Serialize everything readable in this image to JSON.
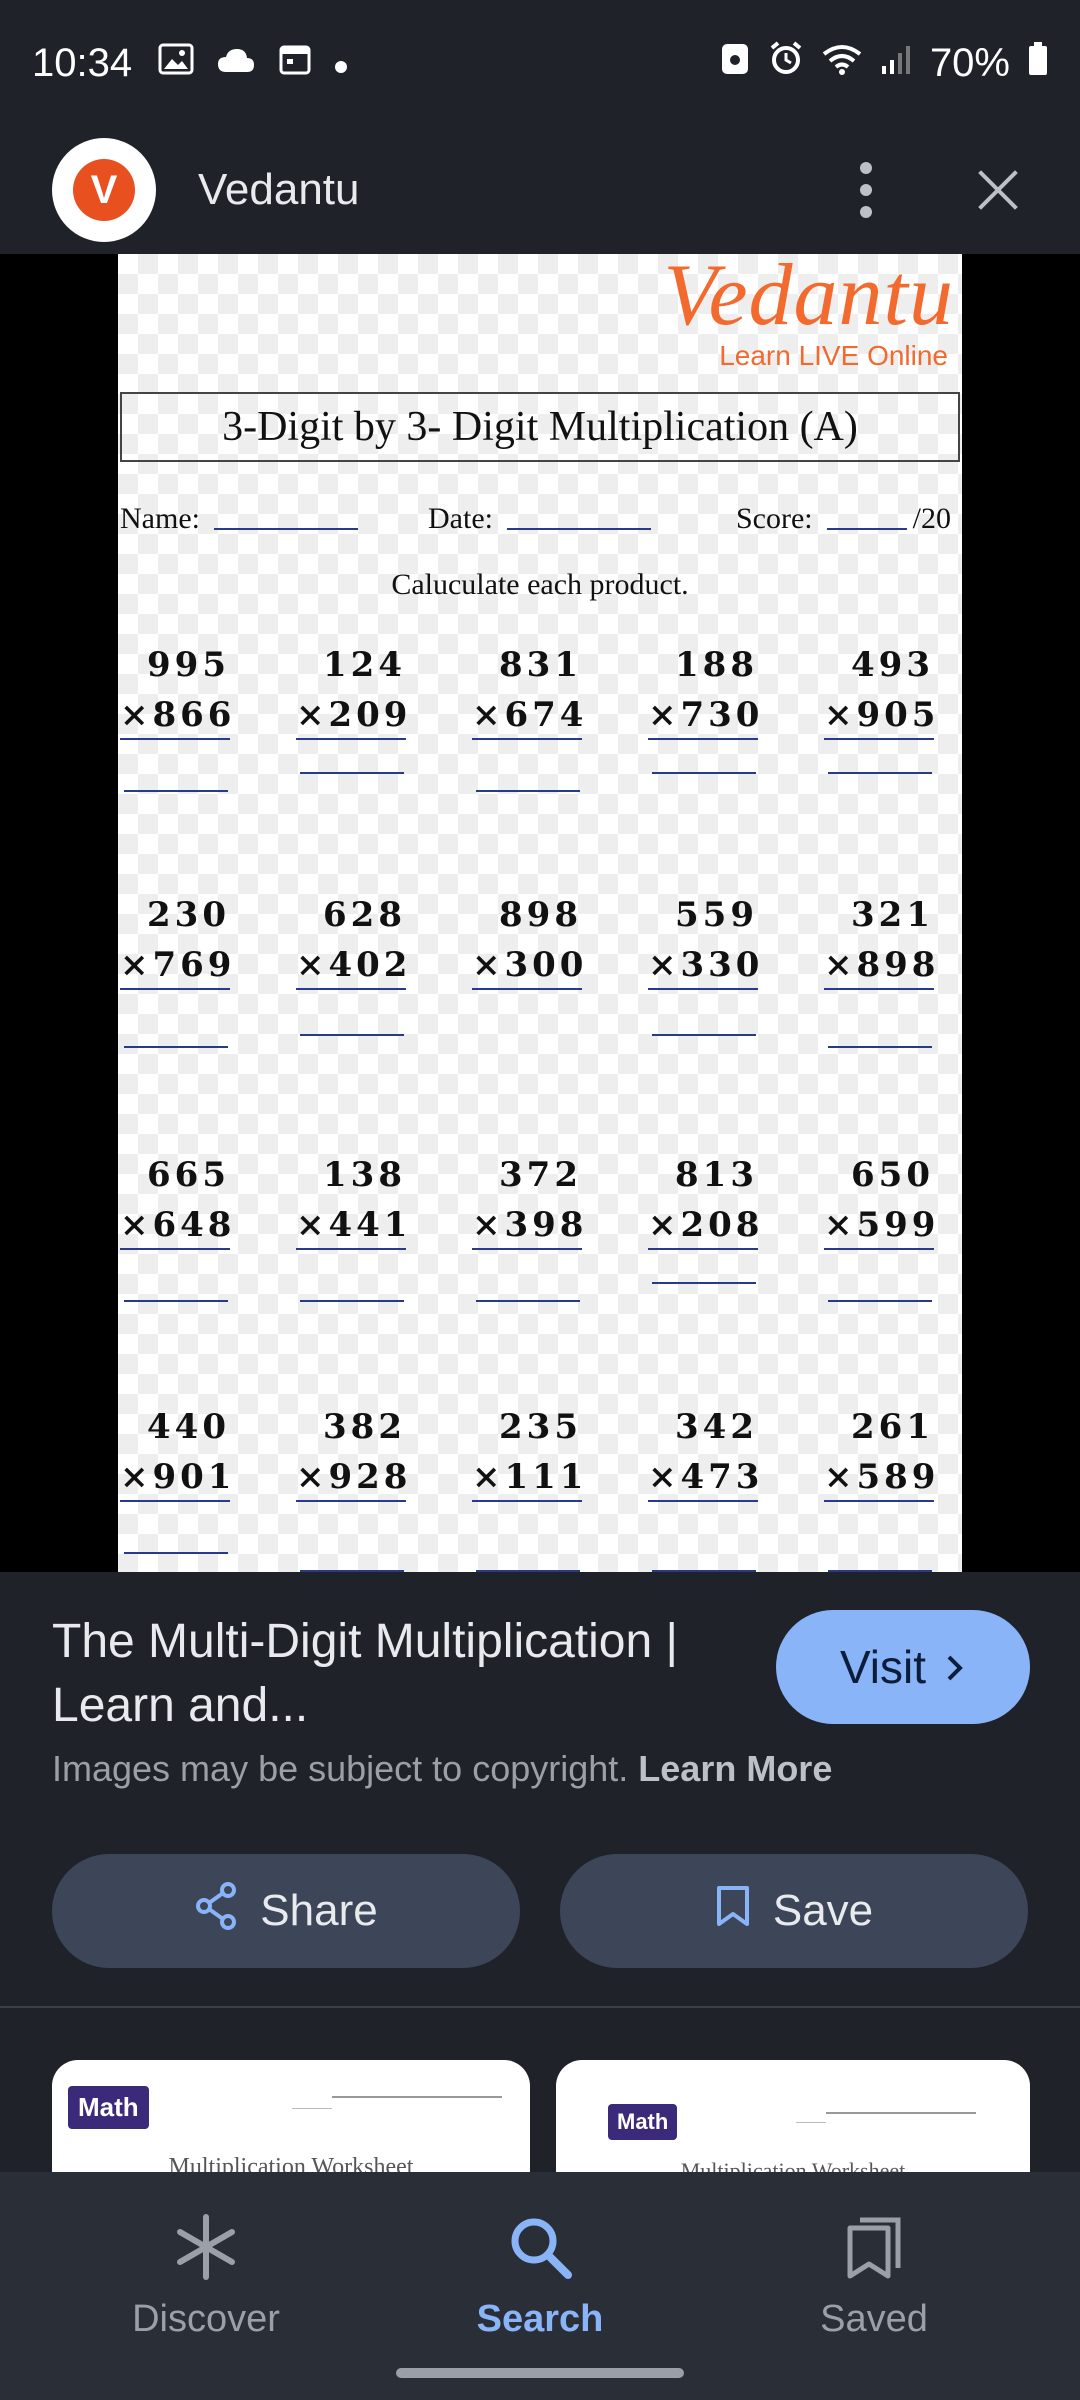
{
  "status_bar": {
    "time": "10:34",
    "battery": "70%"
  },
  "top_bar": {
    "site_name": "Vedantu",
    "logo_letter": "V"
  },
  "worksheet": {
    "brand": "Vedantu",
    "brand_tagline": "Learn LIVE Online",
    "title": "3-Digit by 3- Digit Multiplication (A)",
    "name_label": "Name:",
    "date_label": "Date:",
    "score_label": "Score:",
    "score_total": "/20",
    "instruction": "Caluculate each product.",
    "problems": [
      {
        "a": "995",
        "b": "×866"
      },
      {
        "a": "124",
        "b": "×209"
      },
      {
        "a": "831",
        "b": "×674"
      },
      {
        "a": "188",
        "b": "×730"
      },
      {
        "a": "493",
        "b": "×905"
      },
      {
        "a": "230",
        "b": "×769"
      },
      {
        "a": "628",
        "b": "×402"
      },
      {
        "a": "898",
        "b": "×300"
      },
      {
        "a": "559",
        "b": "×330"
      },
      {
        "a": "321",
        "b": "×898"
      },
      {
        "a": "665",
        "b": "×648"
      },
      {
        "a": "138",
        "b": "×441"
      },
      {
        "a": "372",
        "b": "×398"
      },
      {
        "a": "813",
        "b": "×208"
      },
      {
        "a": "650",
        "b": "×599"
      },
      {
        "a": "440",
        "b": "×901"
      },
      {
        "a": "382",
        "b": "×928"
      },
      {
        "a": "235",
        "b": "×111"
      },
      {
        "a": "342",
        "b": "×473"
      },
      {
        "a": "261",
        "b": "×589"
      }
    ]
  },
  "result": {
    "title": "The Multi-Digit Multiplication | Learn and...",
    "visit_label": "Visit",
    "copyright_text": "Images may be subject to copyright.",
    "learn_more": "Learn More",
    "share_label": "Share",
    "save_label": "Save"
  },
  "related": [
    {
      "badge": "Math",
      "caption": "Multiplication Worksheet"
    },
    {
      "badge": "Math",
      "caption": "Multiplication Worksheet"
    }
  ],
  "nav": {
    "discover": "Discover",
    "search": "Search",
    "saved": "Saved",
    "active_color": "#8ab4f8",
    "inactive_color": "#9aa0a6"
  }
}
